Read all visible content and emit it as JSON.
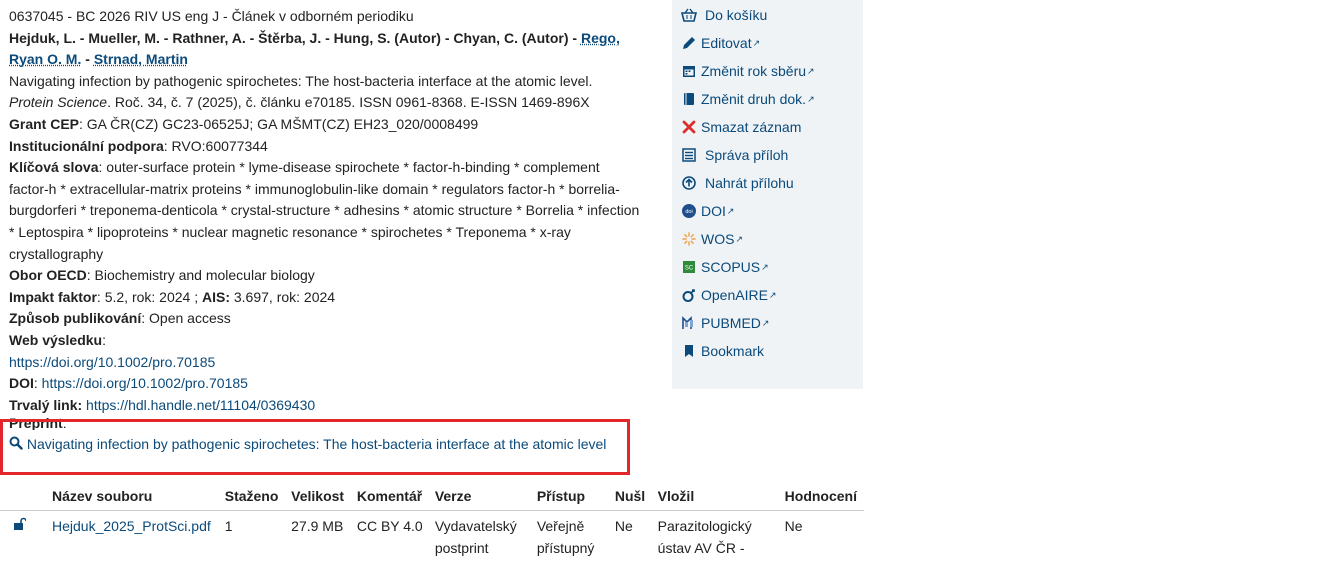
{
  "record": {
    "header": "0637045 - BC 2026 RIV US eng J - Článek v odborném periodiku",
    "authors_plain": "Hejduk, L. - Mueller, M. - Rathner, A. - Štěrba, J. - Hung, S. (Autor) - Chyan, C. (Autor) - ",
    "author_link1": "Rego, Ryan O. M.",
    "author_sep": " - ",
    "author_link2": "Strnad, Martin",
    "title": "Navigating infection by pathogenic spirochetes: The host-bacteria interface at the atomic level.",
    "journal": "Protein Science",
    "journal_info": ". Roč. 34, č. 7 (2025), č. článku e70185. ISSN 0961-8368. E-ISSN 1469-896X",
    "grant_label": "Grant CEP",
    "grant_value": ": GA ČR(CZ) GC23-06525J; GA MŠMT(CZ) EH23_020/0008499",
    "inst_label": "Institucionální podpora",
    "inst_value": ": RVO:60077344",
    "keywords_label": "Klíčová slova",
    "keywords_value": ": outer-surface protein * lyme-disease spirochete * factor-h-binding * complement factor-h * extracellular-matrix proteins * immunoglobulin-like domain * regulators factor-h * borrelia-burgdorferi * treponema-denticola * crystal-structure * adhesins * atomic structure * Borrelia * infection * Leptospira * lipoproteins * nuclear magnetic resonance * spirochetes * Treponema * x-ray crystallography",
    "oecd_label": "Obor OECD",
    "oecd_value": ": Biochemistry and molecular biology",
    "impact_label": "Impakt faktor",
    "impact_value": ": 5.2, rok: 2024 ; ",
    "ais_label": "AIS:",
    "ais_value": " 3.697, rok: 2024",
    "pub_label": "Způsob publikování",
    "pub_value": ": Open access",
    "web_label": "Web výsledku",
    "web_colon": ":",
    "web_link": "https://doi.org/10.1002/pro.70185",
    "doi_label": "DOI",
    "doi_colon": ": ",
    "doi_link": "https://doi.org/10.1002/pro.70185",
    "perm_label": "Trvalý link:",
    "perm_link": "https://hdl.handle.net/11104/0369430",
    "preprint_label": "Preprint",
    "preprint_colon": ":",
    "preprint_link": "Navigating infection by pathogenic spirochetes: The host-bacteria interface at the atomic level"
  },
  "sidebar": {
    "items": [
      {
        "label": "Do košíku",
        "icon": "basket-icon"
      },
      {
        "label": "Editovat",
        "icon": "pencil-icon",
        "ext": true
      },
      {
        "label": "Změnit rok sběru",
        "icon": "calendar-icon",
        "ext": true
      },
      {
        "label": "Změnit druh dok.",
        "icon": "book-icon",
        "ext": true
      },
      {
        "label": "Smazat záznam",
        "icon": "delete-x-icon"
      },
      {
        "label": "Správa příloh",
        "icon": "list-icon"
      },
      {
        "label": "Nahrát přílohu",
        "icon": "upload-icon"
      },
      {
        "label": "DOI",
        "icon": "doi-icon",
        "ext": true
      },
      {
        "label": "WOS",
        "icon": "wos-icon",
        "ext": true
      },
      {
        "label": "SCOPUS",
        "icon": "scopus-icon",
        "ext": true
      },
      {
        "label": "OpenAIRE",
        "icon": "openaire-icon",
        "ext": true
      },
      {
        "label": "PUBMED",
        "icon": "pubmed-icon",
        "ext": true
      },
      {
        "label": "Bookmark",
        "icon": "bookmark-icon"
      }
    ]
  },
  "files": {
    "headers": [
      "Název souboru",
      "Staženo",
      "Velikost",
      "Komentář",
      "Verze",
      "Přístup",
      "Nušl",
      "Vložil",
      "Hodnocení"
    ],
    "row": [
      "Hejduk_2025_ProtSci.pdf",
      "1",
      "27.9 MB",
      "CC BY 4.0",
      "Vydavatelský postprint",
      "Veřejně přístupný",
      "Ne",
      "Parazitologický ústav AV ČR -",
      "Ne"
    ]
  },
  "colors": {
    "link": "#0b4a7a",
    "highlight_border": "#e3262b",
    "sidebar_bg": "#eff3f6",
    "delete": "#d9302c"
  }
}
